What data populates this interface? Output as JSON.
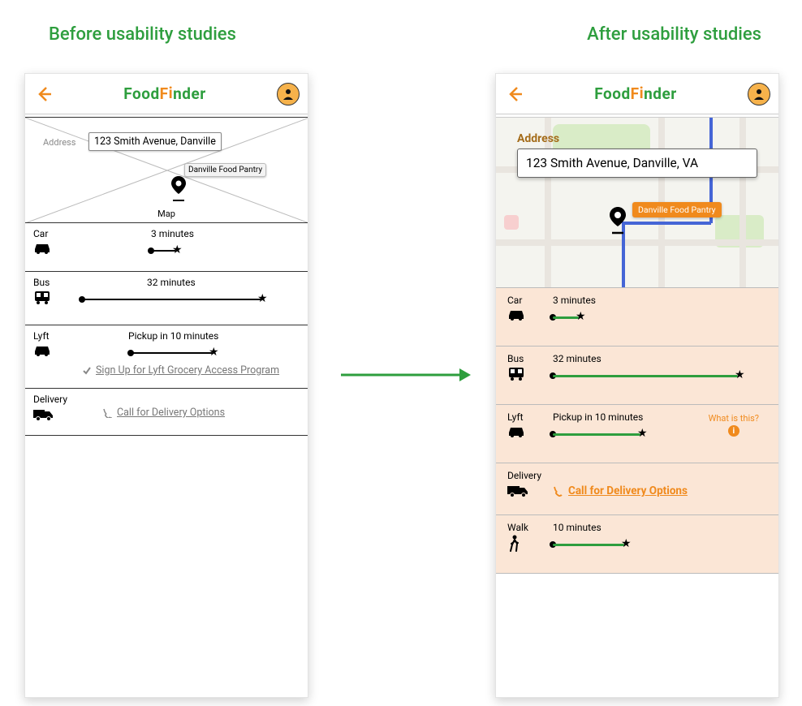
{
  "headings": {
    "before": "Before usability studies",
    "after": "After usability studies"
  },
  "app": {
    "name_part1": "Food",
    "name_part2": "F",
    "name_part3": "nder"
  },
  "before": {
    "address_label": "Address",
    "address_value": "123 Smith Avenue, Danville",
    "pin_label": "Danville Food Pantry",
    "map_label": "Map",
    "rows": {
      "car": {
        "title": "Car",
        "duration": "3 minutes"
      },
      "bus": {
        "title": "Bus",
        "duration": "32 minutes"
      },
      "lyft": {
        "title": "Lyft",
        "duration": "Pickup in 10 minutes",
        "sublink": "Sign Up for Lyft Grocery Access Program"
      },
      "delivery": {
        "title": "Delivery",
        "link": "Call for Delivery Options"
      }
    }
  },
  "after": {
    "address_label": "Address",
    "address_value": "123 Smith Avenue, Danville, VA",
    "pin_label": "Danville Food Pantry",
    "rows": {
      "car": {
        "title": "Car",
        "duration": "3 minutes"
      },
      "bus": {
        "title": "Bus",
        "duration": "32 minutes"
      },
      "lyft": {
        "title": "Lyft",
        "duration": "Pickup in 10 minutes",
        "whatis": "What is this?"
      },
      "delivery": {
        "title": "Delivery",
        "link": "Call for Delivery Options"
      },
      "walk": {
        "title": "Walk",
        "duration": "10 minutes"
      }
    }
  }
}
